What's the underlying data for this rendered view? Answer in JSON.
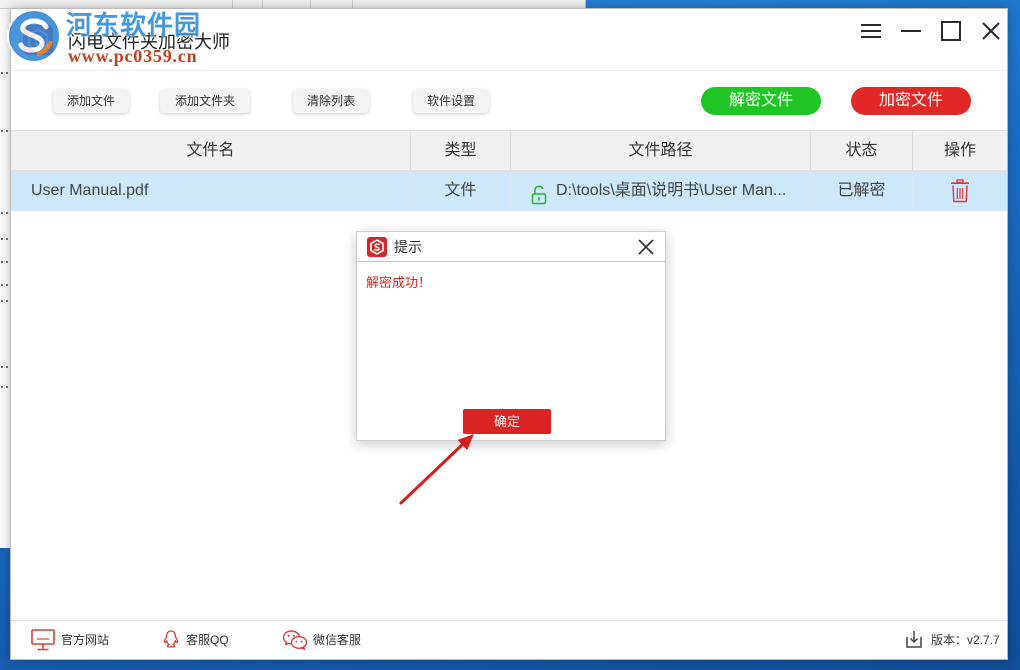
{
  "window": {
    "title": "闪电文件夹加密大师",
    "icons": {
      "app": "app-logo-icon",
      "menu": "menu-icon",
      "minimize": "minimize-icon",
      "maximize": "maximize-icon",
      "close": "close-icon"
    }
  },
  "watermark": {
    "site_name": "河东软件园",
    "site_url": "www.pc0359.cn"
  },
  "toolbar": {
    "add_file": "添加文件",
    "add_folder": "添加文件夹",
    "clear_list": "清除列表",
    "settings": "软件设置",
    "decrypt": "解密文件",
    "encrypt": "加密文件"
  },
  "table": {
    "columns": [
      "文件名",
      "类型",
      "文件路径",
      "状态",
      "操作"
    ],
    "rows": [
      {
        "name": "User Manual.pdf",
        "type": "文件",
        "path": "D:\\tools\\桌面\\说明书\\User Man...",
        "status": "已解密",
        "lock_icon": "unlock-icon",
        "action_icon": "trash-icon"
      }
    ]
  },
  "dialog": {
    "title": "提示",
    "message": "解密成功！",
    "ok_label": "确定",
    "icons": {
      "logo": "dialog-logo-icon",
      "close": "close-icon"
    }
  },
  "footer": {
    "website": "官方网站",
    "qq_support": "客服QQ",
    "wechat_support": "微信客服",
    "version": "版本：v2.7.7",
    "icons": {
      "website": "monitor-icon",
      "qq": "qq-icon",
      "wechat": "wechat-icon",
      "version": "download-icon"
    }
  },
  "colors": {
    "decrypt_button": "#1ec524",
    "encrypt_button": "#e22727",
    "selected_row": "#cde7fb",
    "header_bg": "#f0f0f0",
    "dialog_message": "#e02424",
    "dialog_ok": "#da2424",
    "unlock_icon": "#2bb52e",
    "trash_icon": "#e23b3b",
    "footer_icons": "#d8413a",
    "annotation_arrow": "#d62020"
  }
}
